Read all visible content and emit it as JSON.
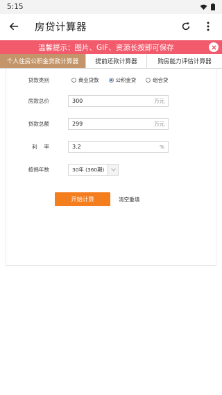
{
  "status_bar": {
    "time": "5:15"
  },
  "app_bar": {
    "title": "房贷计算器"
  },
  "notice": {
    "text": "温馨提示：图片、GIF、资源长按即可保存"
  },
  "tabs": [
    {
      "label": "个人住房公积金贷款计算器"
    },
    {
      "label": "提前还款计算器"
    },
    {
      "label": "购房能力评估计算器"
    }
  ],
  "form": {
    "loan_type": {
      "label": "贷款类别",
      "options": [
        {
          "label": "商业贷款",
          "checked": false
        },
        {
          "label": "公积金贷",
          "checked": true
        },
        {
          "label": "组合贷",
          "checked": false
        }
      ]
    },
    "total_price": {
      "label": "房款总价",
      "value": "300",
      "unit": "万元"
    },
    "loan_amount": {
      "label": "贷款总额",
      "value": "299",
      "unit": "万元"
    },
    "rate": {
      "label": "利    率",
      "value": "3.2",
      "unit": "%"
    },
    "years": {
      "label": "按揭年数",
      "value": "30年 (360期)"
    },
    "calc_button": "开始计算",
    "reset_button": "清空重填"
  },
  "colors": {
    "notice_bg": "#f15b6c",
    "active_tab": "#c4956a",
    "primary_button": "#f47d1e",
    "radio_selected": "#1e6fd6"
  }
}
